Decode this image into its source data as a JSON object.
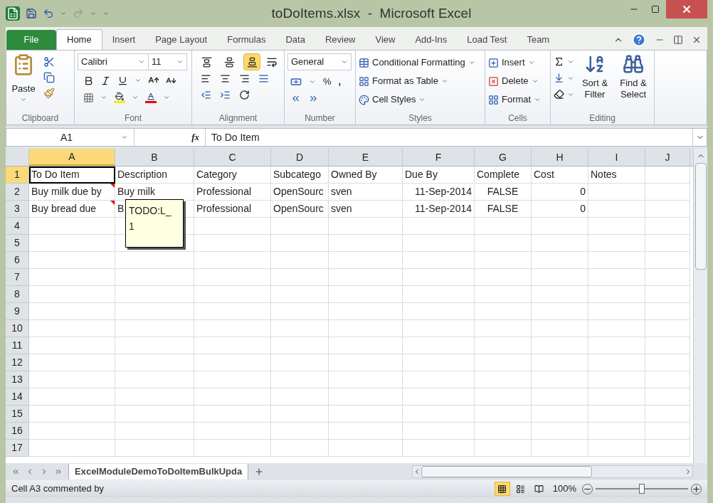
{
  "window": {
    "title": "toDoItems.xlsx  -  Microsoft Excel"
  },
  "tabs": [
    {
      "label": "File",
      "kind": "file",
      "selected": false
    },
    {
      "label": "Home",
      "kind": "tab",
      "selected": true
    },
    {
      "label": "Insert",
      "kind": "tab",
      "selected": false
    },
    {
      "label": "Page Layout",
      "kind": "tab",
      "selected": false
    },
    {
      "label": "Formulas",
      "kind": "tab",
      "selected": false
    },
    {
      "label": "Data",
      "kind": "tab",
      "selected": false
    },
    {
      "label": "Review",
      "kind": "tab",
      "selected": false
    },
    {
      "label": "View",
      "kind": "tab",
      "selected": false
    },
    {
      "label": "Add-Ins",
      "kind": "tab",
      "selected": false
    },
    {
      "label": "Load Test",
      "kind": "tab",
      "selected": false
    },
    {
      "label": "Team",
      "kind": "tab",
      "selected": false
    }
  ],
  "ribbon": {
    "clipboard": {
      "label": "Clipboard",
      "paste": "Paste"
    },
    "font": {
      "label": "Font",
      "font_name": "Calibri",
      "font_size": "11"
    },
    "alignment": {
      "label": "Alignment",
      "vertical": [
        {
          "selected": false
        },
        {
          "selected": false
        },
        {
          "selected": true
        }
      ]
    },
    "number": {
      "label": "Number",
      "format": "General",
      "percent": "%",
      "comma": ","
    },
    "styles": {
      "label": "Styles",
      "items": [
        "Conditional Formatting",
        "Format as Table",
        "Cell Styles"
      ]
    },
    "cells": {
      "label": "Cells",
      "items": [
        "Insert",
        "Delete",
        "Format"
      ]
    },
    "editing": {
      "label": "Editing",
      "items": [
        "Sort & Filter",
        "Find & Select"
      ]
    }
  },
  "formula_bar": {
    "name_box": "A1",
    "function_label": "fx",
    "formula": "To Do Item"
  },
  "columns": [
    {
      "letter": "A",
      "selected": true
    },
    {
      "letter": "B",
      "selected": false
    },
    {
      "letter": "C",
      "selected": false
    },
    {
      "letter": "D",
      "selected": false
    },
    {
      "letter": "E",
      "selected": false
    },
    {
      "letter": "F",
      "selected": false
    },
    {
      "letter": "G",
      "selected": false
    },
    {
      "letter": "H",
      "selected": false
    },
    {
      "letter": "I",
      "selected": false
    },
    {
      "letter": "J",
      "selected": false
    }
  ],
  "rows": [
    {
      "number": "1",
      "selected": true,
      "cells": [
        {
          "text": "To Do Item",
          "kind": "text",
          "commented": false
        },
        {
          "text": "Description",
          "kind": "text",
          "commented": false
        },
        {
          "text": "Category",
          "kind": "text",
          "commented": false
        },
        {
          "text": "Subcatego",
          "kind": "text",
          "commented": false
        },
        {
          "text": "Owned By",
          "kind": "text",
          "commented": false
        },
        {
          "text": "Due By",
          "kind": "text",
          "commented": false
        },
        {
          "text": "Complete",
          "kind": "text",
          "commented": false
        },
        {
          "text": "Cost",
          "kind": "text",
          "commented": false
        },
        {
          "text": "Notes",
          "kind": "text",
          "commented": false
        },
        null
      ]
    },
    {
      "number": "2",
      "selected": false,
      "cells": [
        {
          "text": "Buy milk due by",
          "kind": "text",
          "commented": true
        },
        {
          "text": "Buy milk",
          "kind": "text",
          "commented": false
        },
        {
          "text": "Professional",
          "kind": "text",
          "commented": false
        },
        {
          "text": "OpenSourc",
          "kind": "text",
          "commented": false
        },
        {
          "text": "sven",
          "kind": "text",
          "commented": false
        },
        {
          "text": "11-Sep-2014",
          "kind": "number",
          "commented": false
        },
        {
          "text": "FALSE",
          "kind": "boolean",
          "commented": false
        },
        {
          "text": "0",
          "kind": "number",
          "commented": false
        },
        null,
        null
      ]
    },
    {
      "number": "3",
      "selected": false,
      "cells": [
        {
          "text": "Buy bread due",
          "kind": "text",
          "commented": true
        },
        {
          "text": "B",
          "kind": "text",
          "commented": false
        },
        {
          "text": "Professional",
          "kind": "text",
          "commented": false
        },
        {
          "text": "OpenSourc",
          "kind": "text",
          "commented": false
        },
        {
          "text": "sven",
          "kind": "text",
          "commented": false
        },
        {
          "text": "11-Sep-2014",
          "kind": "number",
          "commented": false
        },
        {
          "text": "FALSE",
          "kind": "boolean",
          "commented": false
        },
        {
          "text": "0",
          "kind": "number",
          "commented": false
        },
        null,
        null
      ]
    },
    {
      "number": "4",
      "selected": false,
      "cells": []
    },
    {
      "number": "5",
      "selected": false,
      "cells": []
    },
    {
      "number": "6",
      "selected": false,
      "cells": []
    },
    {
      "number": "7",
      "selected": false,
      "cells": []
    },
    {
      "number": "8",
      "selected": false,
      "cells": []
    },
    {
      "number": "9",
      "selected": false,
      "cells": []
    },
    {
      "number": "10",
      "selected": false,
      "cells": []
    },
    {
      "number": "11",
      "selected": false,
      "cells": []
    },
    {
      "number": "12",
      "selected": false,
      "cells": []
    },
    {
      "number": "13",
      "selected": false,
      "cells": []
    },
    {
      "number": "14",
      "selected": false,
      "cells": []
    },
    {
      "number": "15",
      "selected": false,
      "cells": []
    },
    {
      "number": "16",
      "selected": false,
      "cells": []
    },
    {
      "number": "17",
      "selected": false,
      "cells": []
    }
  ],
  "comment": {
    "lines": [
      "TODO:L_",
      "1"
    ]
  },
  "sheet_tabs": [
    {
      "label": "ExcelModuleDemoToDoItemBulkUpda",
      "selected": true
    }
  ],
  "status_bar": {
    "text": "Cell A3 commented by",
    "zoom": "100%",
    "views": [
      {
        "selected": true
      },
      {
        "selected": false
      },
      {
        "selected": false
      }
    ],
    "level": 0.5
  }
}
